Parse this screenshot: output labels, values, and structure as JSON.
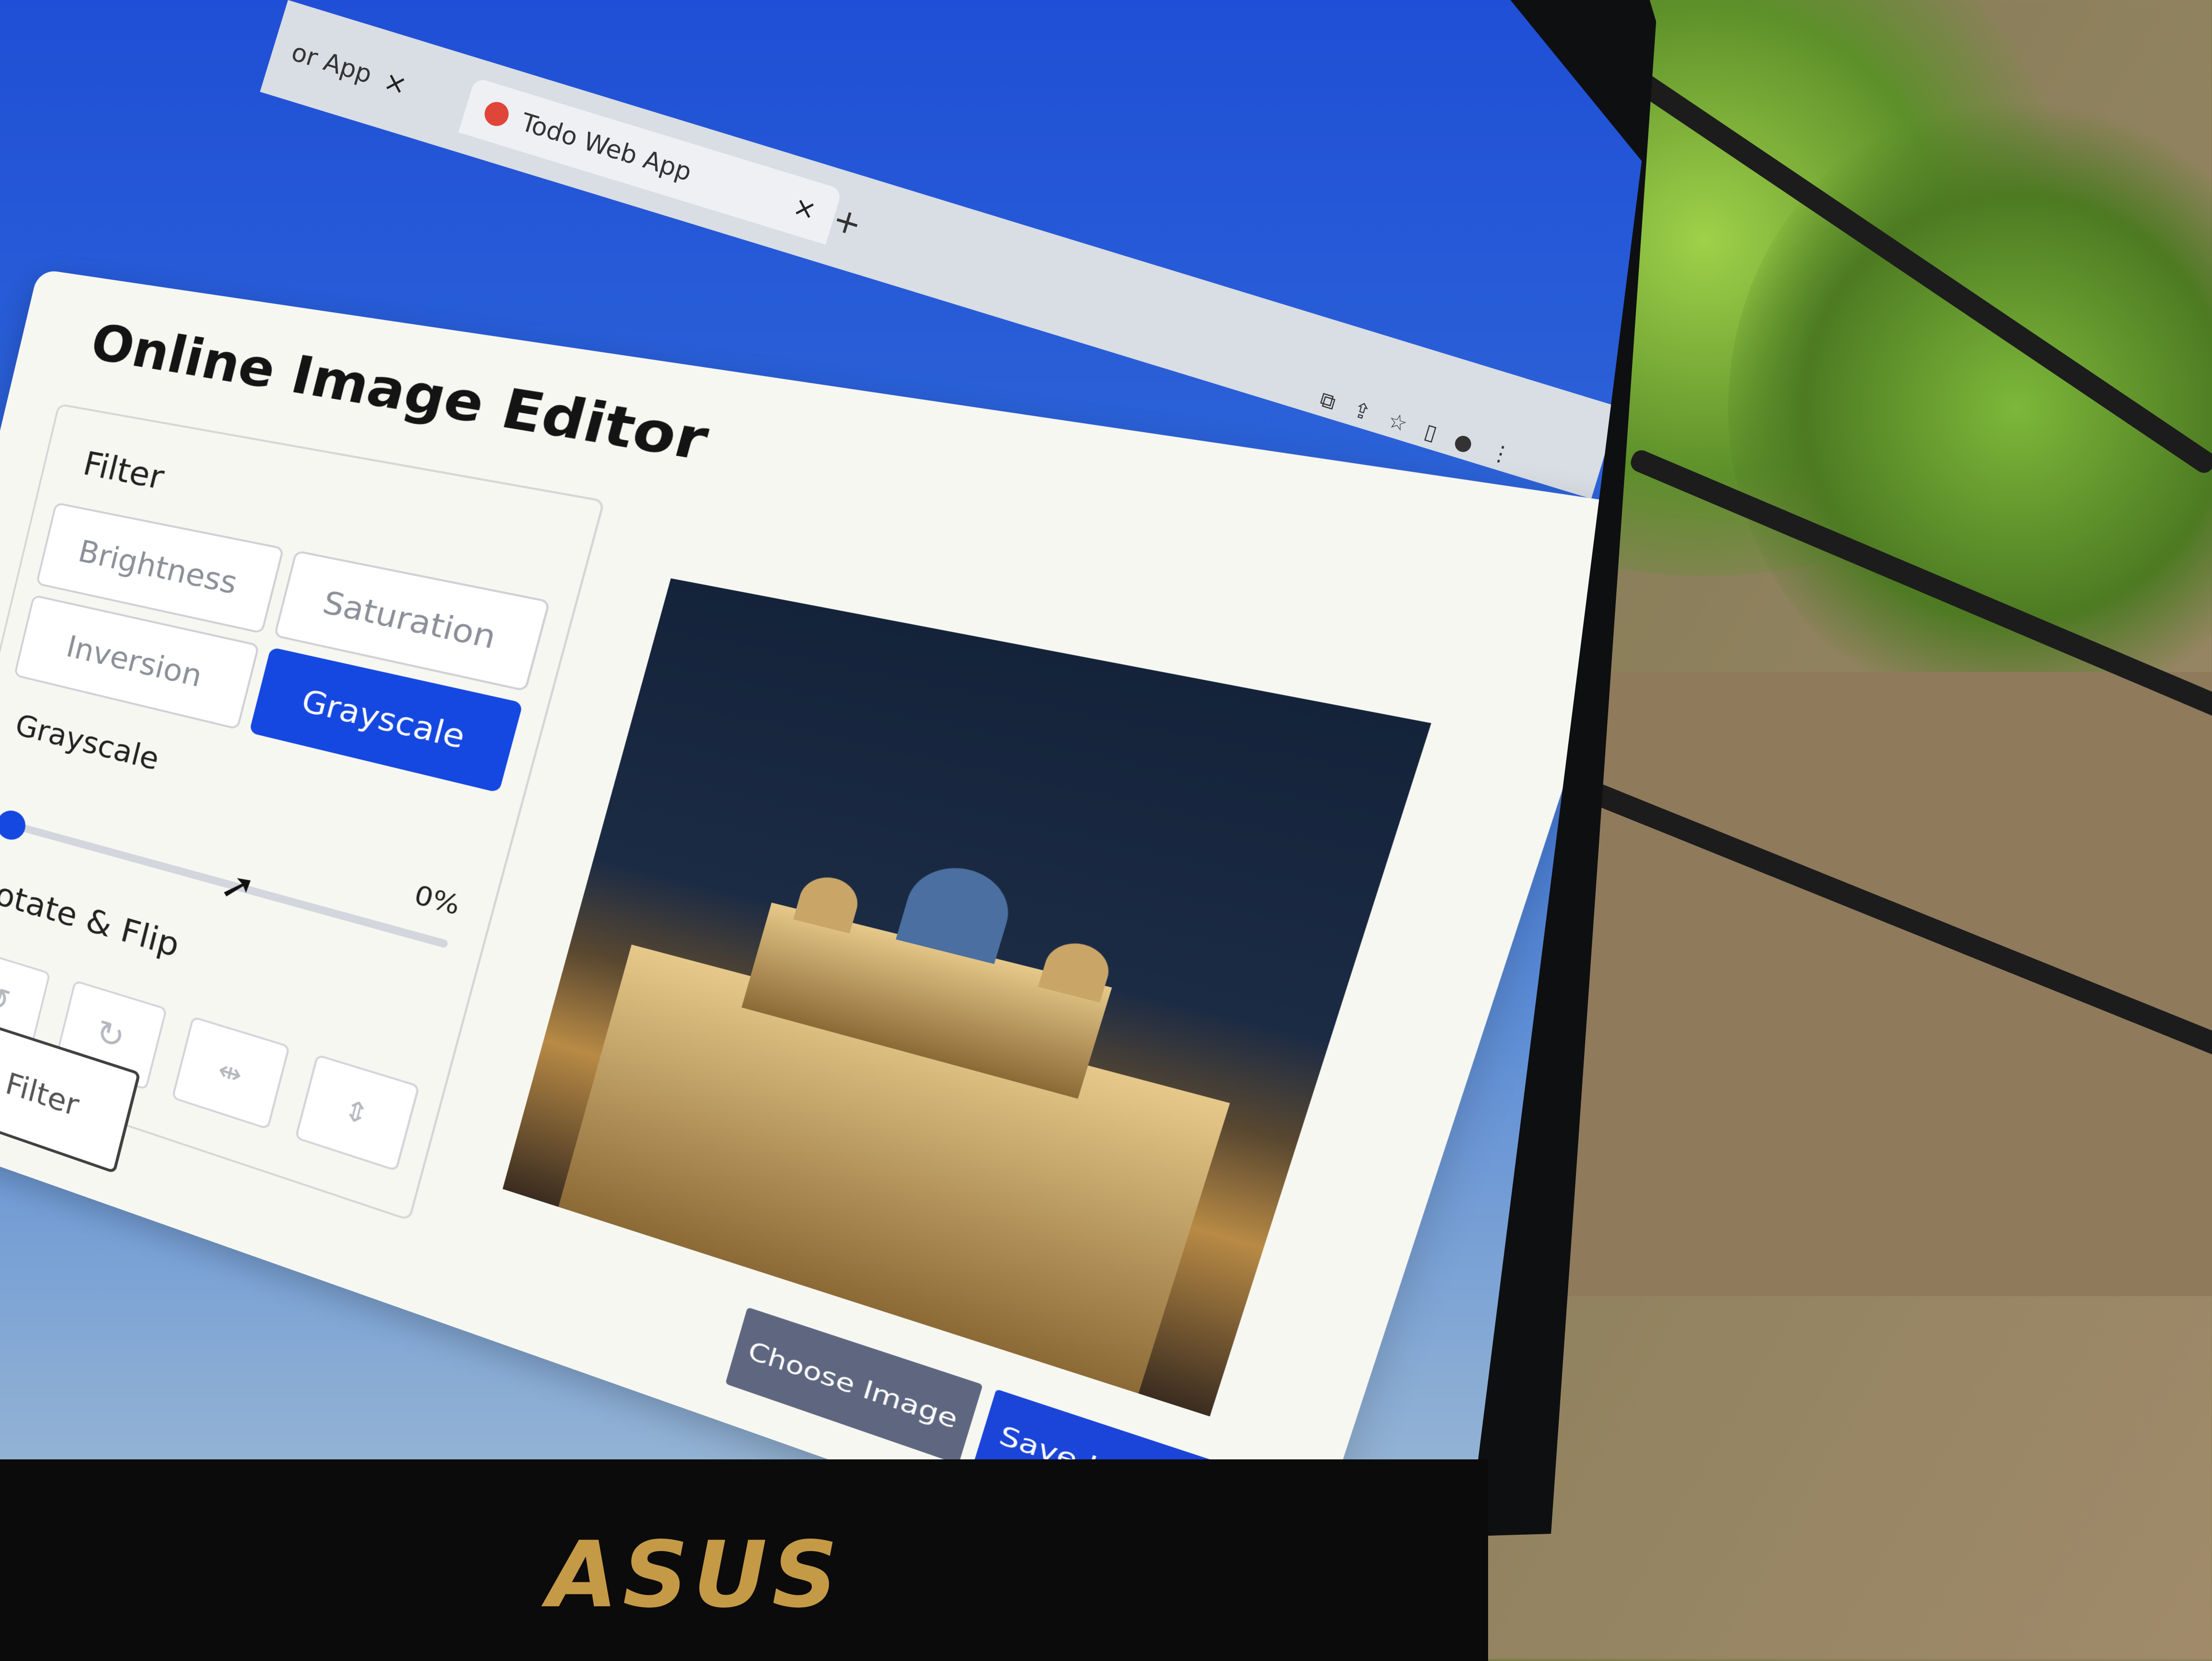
{
  "browser": {
    "tab_prev_partial": "or App",
    "tab_prev_close": "×",
    "tab_active": "Todo Web App",
    "tab_active_close": "×",
    "new_tab": "+",
    "icons": [
      "extension-icon",
      "share-icon",
      "star-icon",
      "sidebar-icon",
      "profile-icon",
      "menu-icon"
    ]
  },
  "app": {
    "title": "Online Image Editor",
    "filter": {
      "heading": "Filter",
      "buttons": [
        "Brightness",
        "Saturation",
        "Inversion",
        "Grayscale"
      ],
      "active": "Grayscale"
    },
    "slider": {
      "label": "Grayscale",
      "value": "0%",
      "level": 0
    },
    "rotate_flip": {
      "heading": "Rotate & Flip",
      "icons": [
        "rotate-left-icon",
        "rotate-right-icon",
        "flip-horizontal-icon",
        "flip-vertical-icon"
      ]
    },
    "reset_label": "Reset Filter",
    "choose_label": "Choose Image",
    "save_label": "Save Image"
  },
  "laptop": {
    "brand": "ASUS"
  },
  "colors": {
    "accent": "#1548e0",
    "choose": "#5f6780"
  }
}
